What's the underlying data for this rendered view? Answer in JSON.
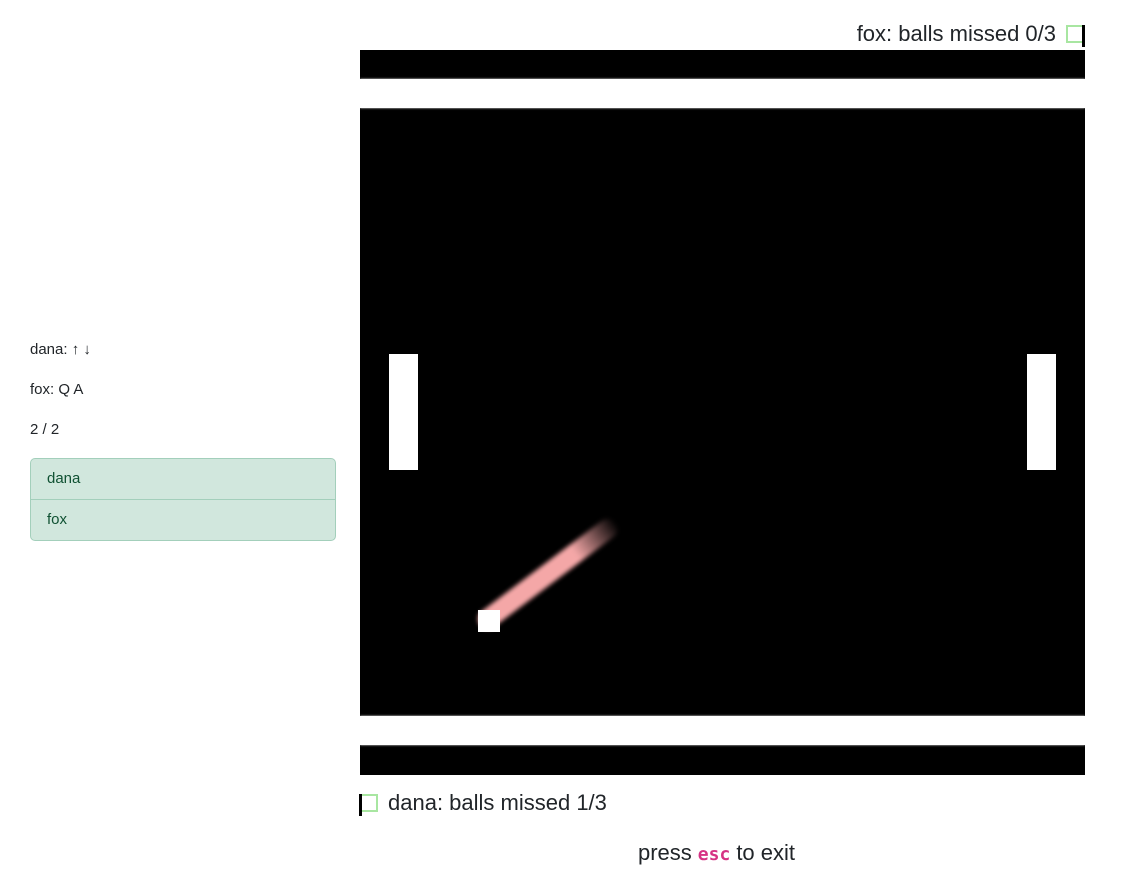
{
  "sidebar": {
    "controls": {
      "dana": "dana: ↑ ↓",
      "fox": "fox: Q A"
    },
    "player_count": "2 / 2",
    "players": [
      {
        "name": "dana"
      },
      {
        "name": "fox"
      }
    ]
  },
  "status": {
    "top": "fox: balls missed 0/3",
    "bottom": "dana: balls missed 1/3"
  },
  "footer": {
    "before": "press",
    "key": "esc",
    "after": "to exit"
  },
  "colors": {
    "background": "#000000",
    "foreground": "#ffffff",
    "trail": "#f4a7a7",
    "indicator": "#a8e6a1",
    "key": "#d63384",
    "list_bg": "#d1e7dd"
  }
}
